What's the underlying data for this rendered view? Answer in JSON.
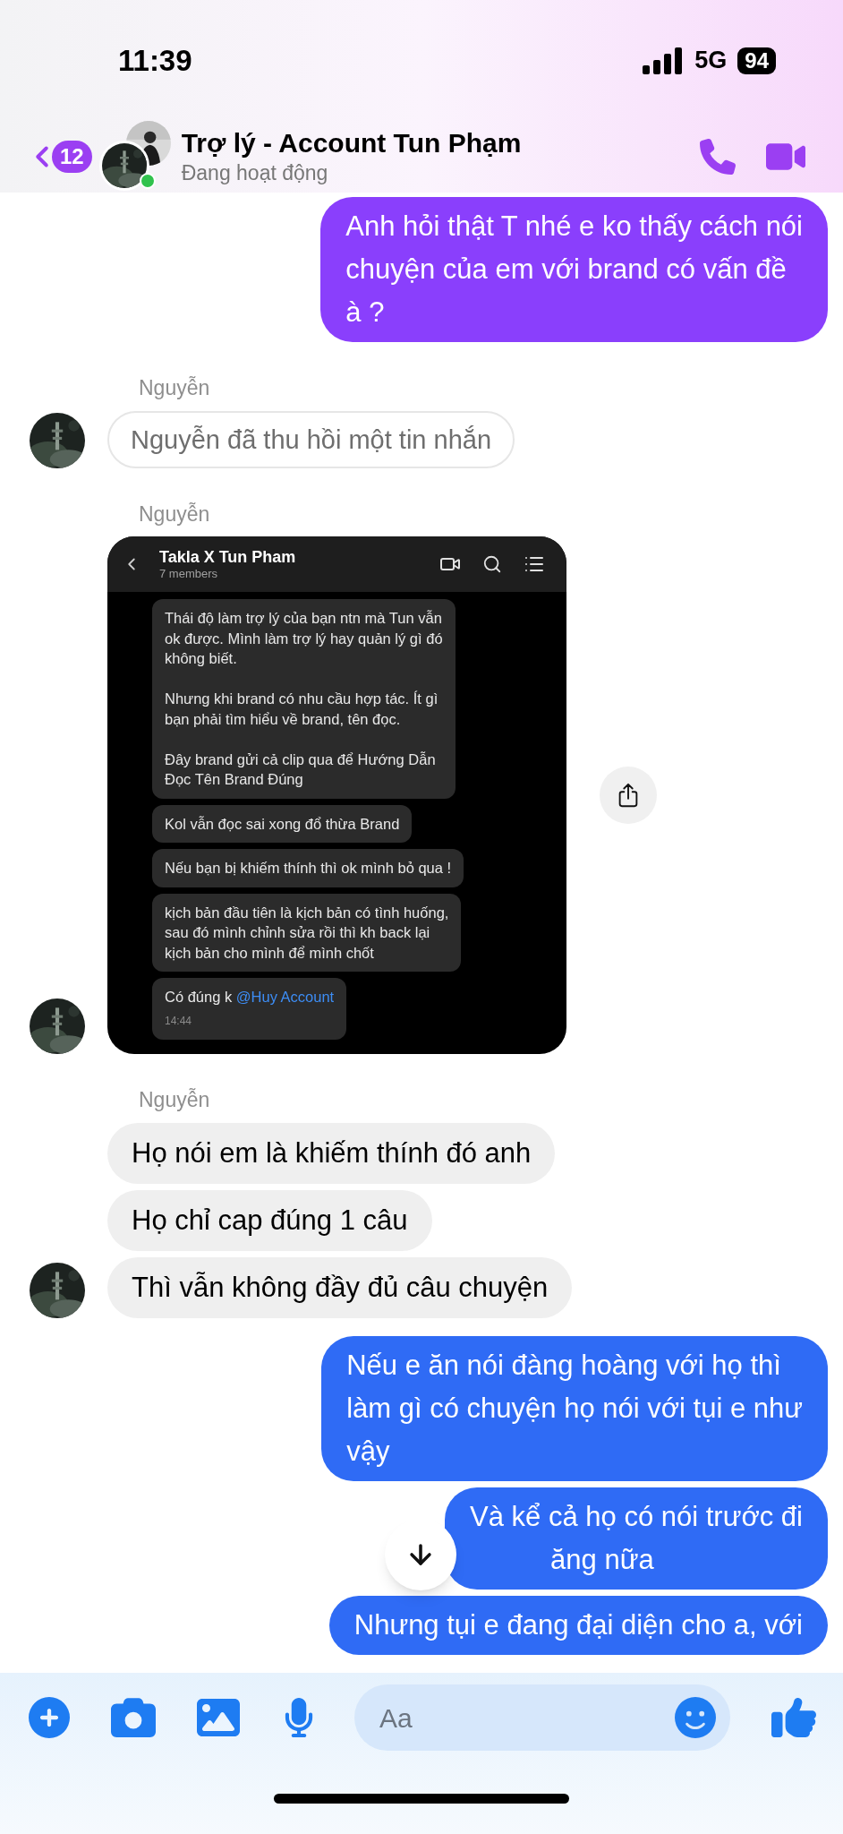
{
  "status_bar": {
    "time": "11:39",
    "network": "5G",
    "battery": "94"
  },
  "header": {
    "back_count": "12",
    "title": "Trợ lý - Account Tun Phạm",
    "status": "Đang hoạt động",
    "online": true
  },
  "messages": [
    {
      "kind": "outgoing",
      "color": "#8a3ffc",
      "lines": [
        "Anh hỏi thật T nhé e ko thấy cách nói",
        "chuyện của em với brand có vấn đề",
        "à ?"
      ]
    },
    {
      "kind": "sender",
      "name": "Nguyễn"
    },
    {
      "kind": "recalled",
      "text": "Nguyễn đã thu hồi một tin nhắn",
      "avatar": true
    },
    {
      "kind": "sender",
      "name": "Nguyễn"
    },
    {
      "kind": "screenshot",
      "avatar": true,
      "title": "Takla X Tun Pham",
      "subtitle": "7 members",
      "bubbles": [
        {
          "text": "Thái độ làm trợ lý của bạn ntn mà Tun vẫn\nok được. Mình làm trợ lý hay quản lý gì đó\nkhông biết.\n\nNhưng khi brand có nhu cầu hợp tác. Ít gì\nbạn phải tìm hiểu về brand, tên đọc.\n\nĐây brand gửi cả clip qua để Hướng Dẫn\nĐọc Tên Brand Đúng"
        },
        {
          "text": "Kol vẫn đọc sai xong đổ thừa Brand"
        },
        {
          "text": "Nếu bạn bị khiếm thính thì ok mình bỏ qua !"
        },
        {
          "text": "kịch bản đầu tiên là kịch bản có tình huống,\nsau đó mình chỉnh sửa rồi thì kh back lại\nkịch bản cho mình để mình chốt"
        },
        {
          "text": "Có đúng k",
          "mention": "@Huy Account",
          "time": "14:44"
        }
      ]
    },
    {
      "kind": "sender",
      "name": "Nguyễn"
    },
    {
      "kind": "incoming",
      "text": "Họ nói em là khiếm thính đó anh",
      "avatar": false
    },
    {
      "kind": "incoming",
      "text": "Họ chỉ cap đúng 1 câu",
      "avatar": false
    },
    {
      "kind": "incoming",
      "text": "Thì vẫn không đầy đủ câu chuyện",
      "avatar": true
    },
    {
      "kind": "outgoing",
      "color": "#2f6bf5",
      "lines": [
        "Nếu e ăn nói đàng hoàng với họ thì",
        "làm gì có chuyện họ nói với tụi e như",
        "vậy"
      ]
    },
    {
      "kind": "outgoing",
      "color": "#2f6bf5",
      "lines": [
        "Và kể cả họ có nói trước đi",
        "ăng nữa"
      ]
    },
    {
      "kind": "outgoing",
      "color": "#2f6bf5",
      "lines": [
        "Nhưng tụi e đang đại diện cho a, với"
      ]
    }
  ],
  "composer": {
    "placeholder": "Aa"
  }
}
